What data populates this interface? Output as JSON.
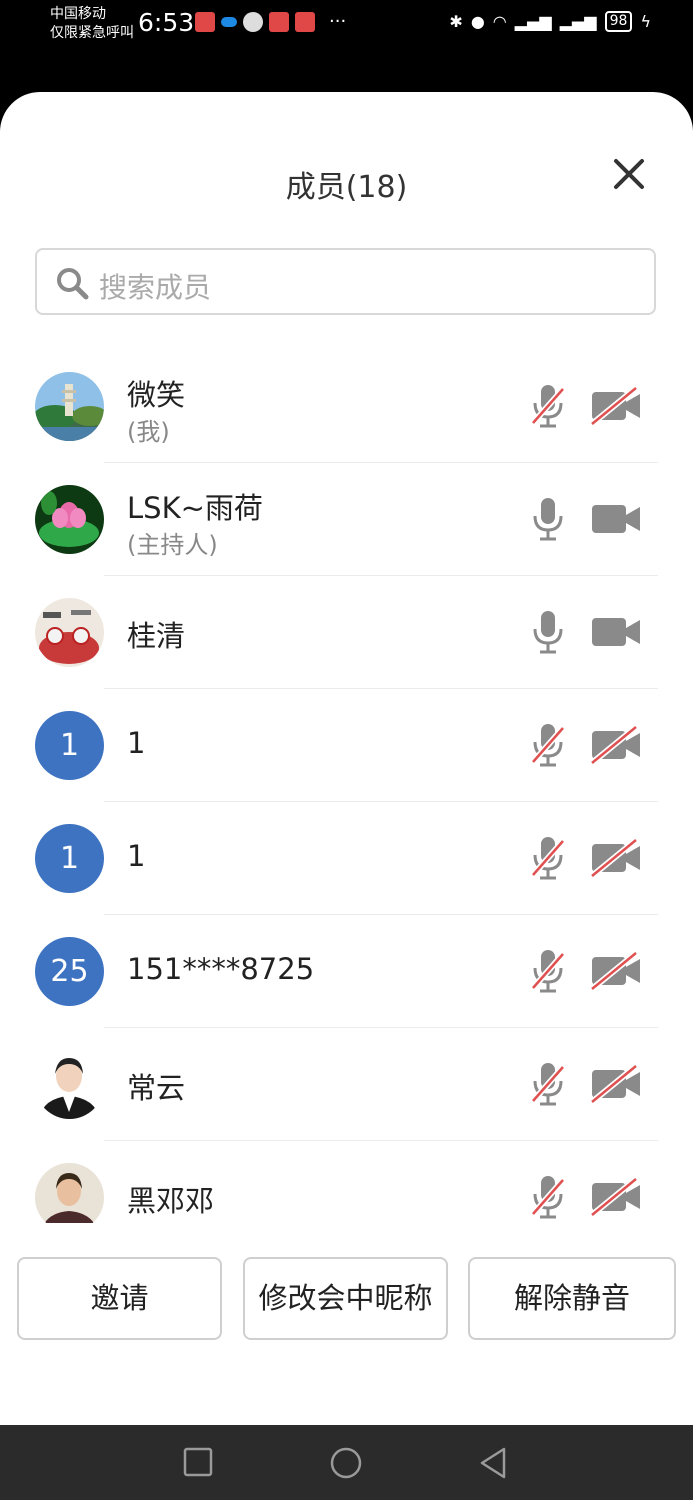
{
  "status_bar": {
    "carrier_line1": "中国移动",
    "carrier_line2": "仅限紧急呼叫",
    "time": "6:53",
    "battery": "98",
    "dots": "···"
  },
  "sheet": {
    "title": "成员(18)",
    "search_placeholder": "搜索成员"
  },
  "members": [
    {
      "name": "微笑",
      "sub": "(我)",
      "avatar": "photo-pagoda",
      "mic_muted": true,
      "cam_off": true
    },
    {
      "name": "LSK~雨荷",
      "sub": "(主持人)",
      "avatar": "photo-lotus",
      "mic_muted": false,
      "cam_off": false
    },
    {
      "name": "桂清",
      "sub": "",
      "avatar": "photo-pattern",
      "mic_muted": false,
      "cam_off": false
    },
    {
      "name": "1",
      "sub": "",
      "avatar_text": "1",
      "mic_muted": true,
      "cam_off": true
    },
    {
      "name": "1",
      "sub": "",
      "avatar_text": "1",
      "mic_muted": true,
      "cam_off": true
    },
    {
      "name": "151****8725",
      "sub": "",
      "avatar_text": "25",
      "mic_muted": true,
      "cam_off": true
    },
    {
      "name": "常云",
      "sub": "",
      "avatar": "photo-portrait-suit",
      "mic_muted": true,
      "cam_off": true
    },
    {
      "name": "黑邓邓",
      "sub": "",
      "avatar": "photo-portrait",
      "mic_muted": true,
      "cam_off": true
    }
  ],
  "actions": {
    "invite": "邀请",
    "rename": "修改会中昵称",
    "unmute": "解除静音"
  },
  "colors": {
    "accent": "#3e73c2",
    "muted_slash": "#e05050",
    "icon_gray": "#8a8a8a"
  }
}
